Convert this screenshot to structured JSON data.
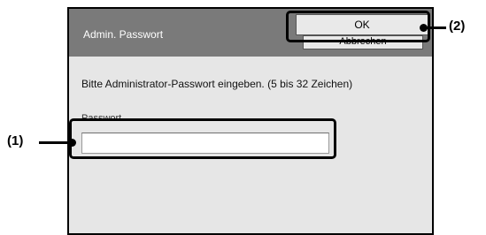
{
  "dialog": {
    "title": "Admin. Passwort",
    "ok_label": "OK",
    "cancel_label": "Abbrechen",
    "instruction": "Bitte Administrator-Passwort eingeben. (5 bis 32 Zeichen)",
    "password_label": "Passwort",
    "password_value": ""
  },
  "callouts": {
    "one": "(1)",
    "two": "(2)"
  }
}
